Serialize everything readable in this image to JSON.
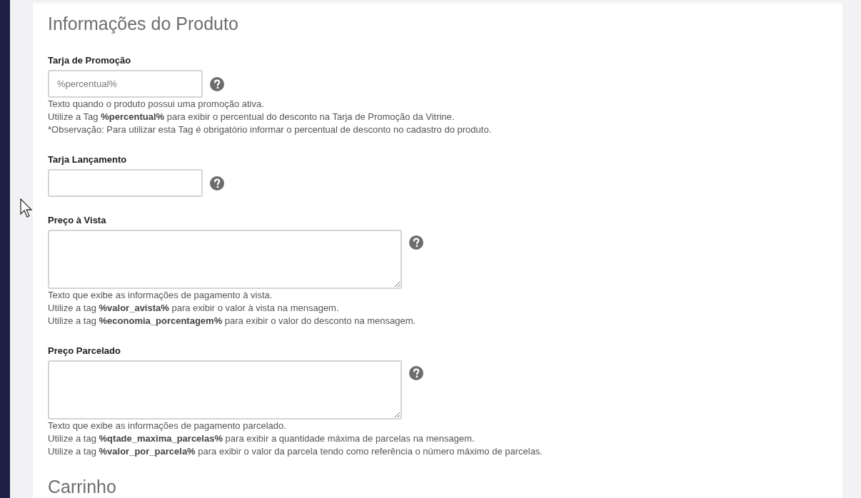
{
  "section_title": "Informações do Produto",
  "fields": [
    {
      "label": "Tarja de Promoção",
      "kind": "input",
      "placeholder": "%percentual%",
      "hints": [
        "Texto quando o produto possui uma promoção ativa.",
        "Utilize a Tag **%percentual%** para exibir o percentual do desconto na Tarja de Promoção da Vitrine.",
        "*Observação: Para utilizar esta Tag é obrigatório informar o percentual de desconto no cadastro do produto."
      ]
    },
    {
      "label": "Tarja Lançamento",
      "kind": "input"
    },
    {
      "label": "Preço à Vista",
      "kind": "textarea",
      "hints": [
        "Texto que exibe as informações de pagamento à vista.",
        "Utilize a tag **%valor_avista%** para exibir o valor à vista na mensagem.",
        "Utilize a tag **%economia_porcentagem%** para exibir o valor do desconto na mensagem."
      ]
    },
    {
      "label": "Preço Parcelado",
      "kind": "textarea",
      "hints": [
        "Texto que exibe as informações de pagamento parcelado.",
        "Utilize a tag **%qtade_maxima_parcelas%** para exibir a quantidade máxima de parcelas na mensagem.",
        "Utilize a tag **%valor_por_parcela%** para exibir o valor da parcela tendo como referência o número máximo de parcelas."
      ]
    }
  ],
  "next_section_title": "Carrinho"
}
